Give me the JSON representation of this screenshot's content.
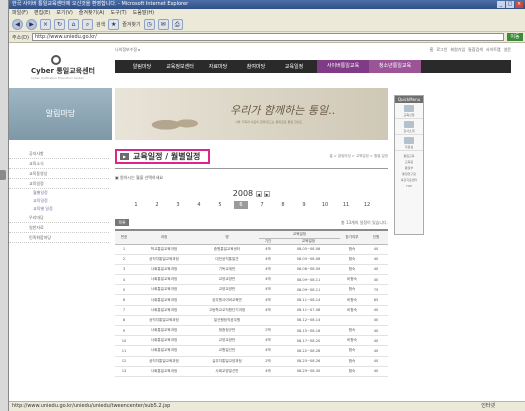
{
  "window": {
    "title": "한국 사이버 통일교육센터에 오신것을 환영합니다. - Microsoft Internet Explorer",
    "minimize": "_",
    "maximize": "□",
    "close": "×"
  },
  "menu": [
    "파일(F)",
    "편집(E)",
    "보기(V)",
    "즐겨찾기(A)",
    "도구(T)",
    "도움말(H)"
  ],
  "toolbar": {
    "search_label": "검색",
    "favorites_label": "즐겨찾기"
  },
  "address": {
    "label": "주소(D)",
    "url": "http://www.uniedu.go.kr/",
    "go": "이동"
  },
  "status": {
    "url": "http://www.uniedu.go.kr/uniedu/uniedu/tweencenter/sub5.2.jsp",
    "zone": "인터넷"
  },
  "site": {
    "logo_title": "Cyber 통일교육센터",
    "logo_sub": "Cyber Unification Education Center",
    "util_left": "나의정보수정 ▸",
    "util_right": [
      "홈",
      "로그인",
      "회원가입",
      "통합검색",
      "사이트맵",
      "영문"
    ],
    "gnb": [
      "알림마당",
      "교육정보센터",
      "자료마당",
      "참여마당",
      "교육일정",
      "사이버통일교육",
      "청소년통일교육"
    ],
    "hero_left": "알림마당",
    "slogan": "우리가 함께하는 통일..",
    "slogan_sub": "나와 가족과 이웃이 함께 만드는 평화로운 통일 한반도"
  },
  "quickmenu": {
    "title": "QuickMenu",
    "items": [
      "교육신청",
      "강사소개",
      "자료실"
    ],
    "links": [
      "통일교육",
      "교육원",
      "통일부",
      "통일연구원",
      "북한자료센터",
      "TOP"
    ]
  },
  "lnb": {
    "items": [
      "공지사항",
      "교육소식",
      "교육동영상",
      "교육일정",
      "우리마당",
      "일반자료",
      "민족화합마당"
    ],
    "sub": [
      "월별일정",
      "교육일정",
      "교육별 일정"
    ]
  },
  "content": {
    "page_title": "교육일정 / 월별일정",
    "title_icon": "▶",
    "breadcrumb": "홈 > 알림마당 > 교육일정 > 월별 일정",
    "select_hint": "▣ 원하시는 월을 선택하세요",
    "year": "2008",
    "prev": "◀",
    "next": "▶",
    "months": [
      "1",
      "2",
      "3",
      "4",
      "5",
      "6",
      "7",
      "8",
      "9",
      "10",
      "11",
      "12"
    ],
    "active_month": "6",
    "list_button": "목록",
    "count_text": "총 13개의 일정이 있습니다."
  },
  "table": {
    "headers": [
      "번호",
      "과정",
      "명",
      "교육일정",
      "참가여부",
      "인원"
    ],
    "subheaders": [
      "기간",
      "교육일정"
    ],
    "rows": [
      [
        "1",
        "학교통일교육과정",
        "중원통일교육센터",
        "4박",
        "08.05~08.06",
        "합숙",
        "40"
      ],
      [
        "2",
        "공직자통일교육과정",
        "대전공직통일관",
        "4박",
        "08.05~08.06",
        "합숙",
        "40"
      ],
      [
        "3",
        "사회통일교육과정",
        "기독교계반",
        "4박",
        "08.06~08.09",
        "합숙",
        "40"
      ],
      [
        "4",
        "사회통일교육과정",
        "교양교양반",
        "4박",
        "08.09~08.11",
        "비합숙",
        "40"
      ],
      [
        "5",
        "사회통일교육과정",
        "교양교양반",
        "4박",
        "08.09~08.11",
        "합숙",
        "75"
      ],
      [
        "6",
        "사회통일교육과정",
        "공무원사이버교육반",
        "4박",
        "08.11~08.14",
        "비합숙",
        "65"
      ],
      [
        "7",
        "사회통일교육과정",
        "고등학교교직원단기과정",
        "4박",
        "08.11~07.08",
        "비합숙",
        "40"
      ],
      [
        "8",
        "공직자통일교육과정",
        "일선행정직공무원",
        "",
        "08.12~08.14",
        "",
        "40"
      ],
      [
        "9",
        "사회통일교육과정",
        "청중정규반",
        "2박",
        "08.15~08.16",
        "합숙",
        "40"
      ],
      [
        "10",
        "사회통일교육과정",
        "교양교양반",
        "4박",
        "08.17~08.20",
        "비합숙",
        "40"
      ],
      [
        "11",
        "사회통일교육과정",
        "교원일선반",
        "4박",
        "08.22~08.28",
        "합숙",
        "40"
      ],
      [
        "12",
        "공직자통일교육과정",
        "실무자통일교양과정",
        "2박",
        "08.25~08.26",
        "합숙",
        "40"
      ],
      [
        "13",
        "사회통일교육과정",
        "사회교양일선반",
        "4박",
        "08.29~08.30",
        "합숙",
        "40"
      ]
    ]
  },
  "colors": {
    "highlight_border": "#e0248a",
    "gnb_bg": "#2a2a2a",
    "gnb_accent": "#7f3b86"
  }
}
